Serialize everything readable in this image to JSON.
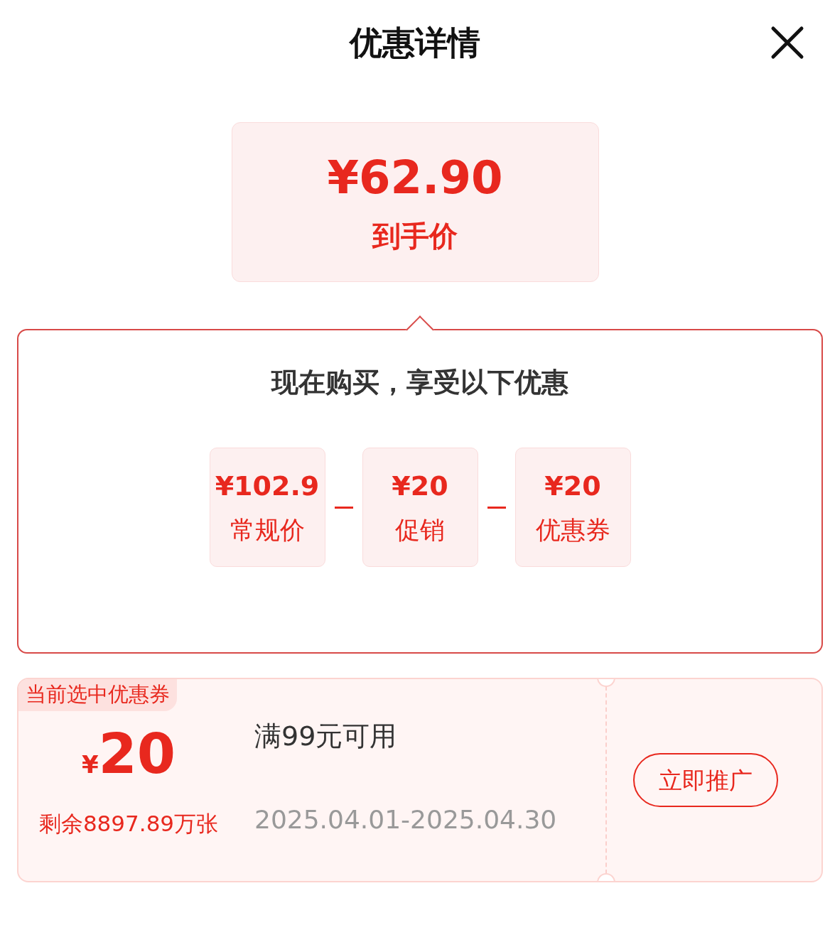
{
  "dialog": {
    "title": "优惠详情"
  },
  "final_price": {
    "amount": "¥62.90",
    "label": "到手价"
  },
  "breakdown": {
    "heading": "现在购买，享受以下优惠",
    "items": [
      {
        "amount": "¥102.9",
        "label": "常规价"
      },
      {
        "amount": "¥20",
        "label": "促销"
      },
      {
        "amount": "¥20",
        "label": "优惠券"
      }
    ]
  },
  "coupon": {
    "badge": "当前选中优惠券",
    "currency": "¥",
    "amount": "20",
    "remaining": "剩余8897.89万张",
    "condition": "满99元可用",
    "validity": "2025.04.01-2025.04.30",
    "action": "立即推广"
  }
}
